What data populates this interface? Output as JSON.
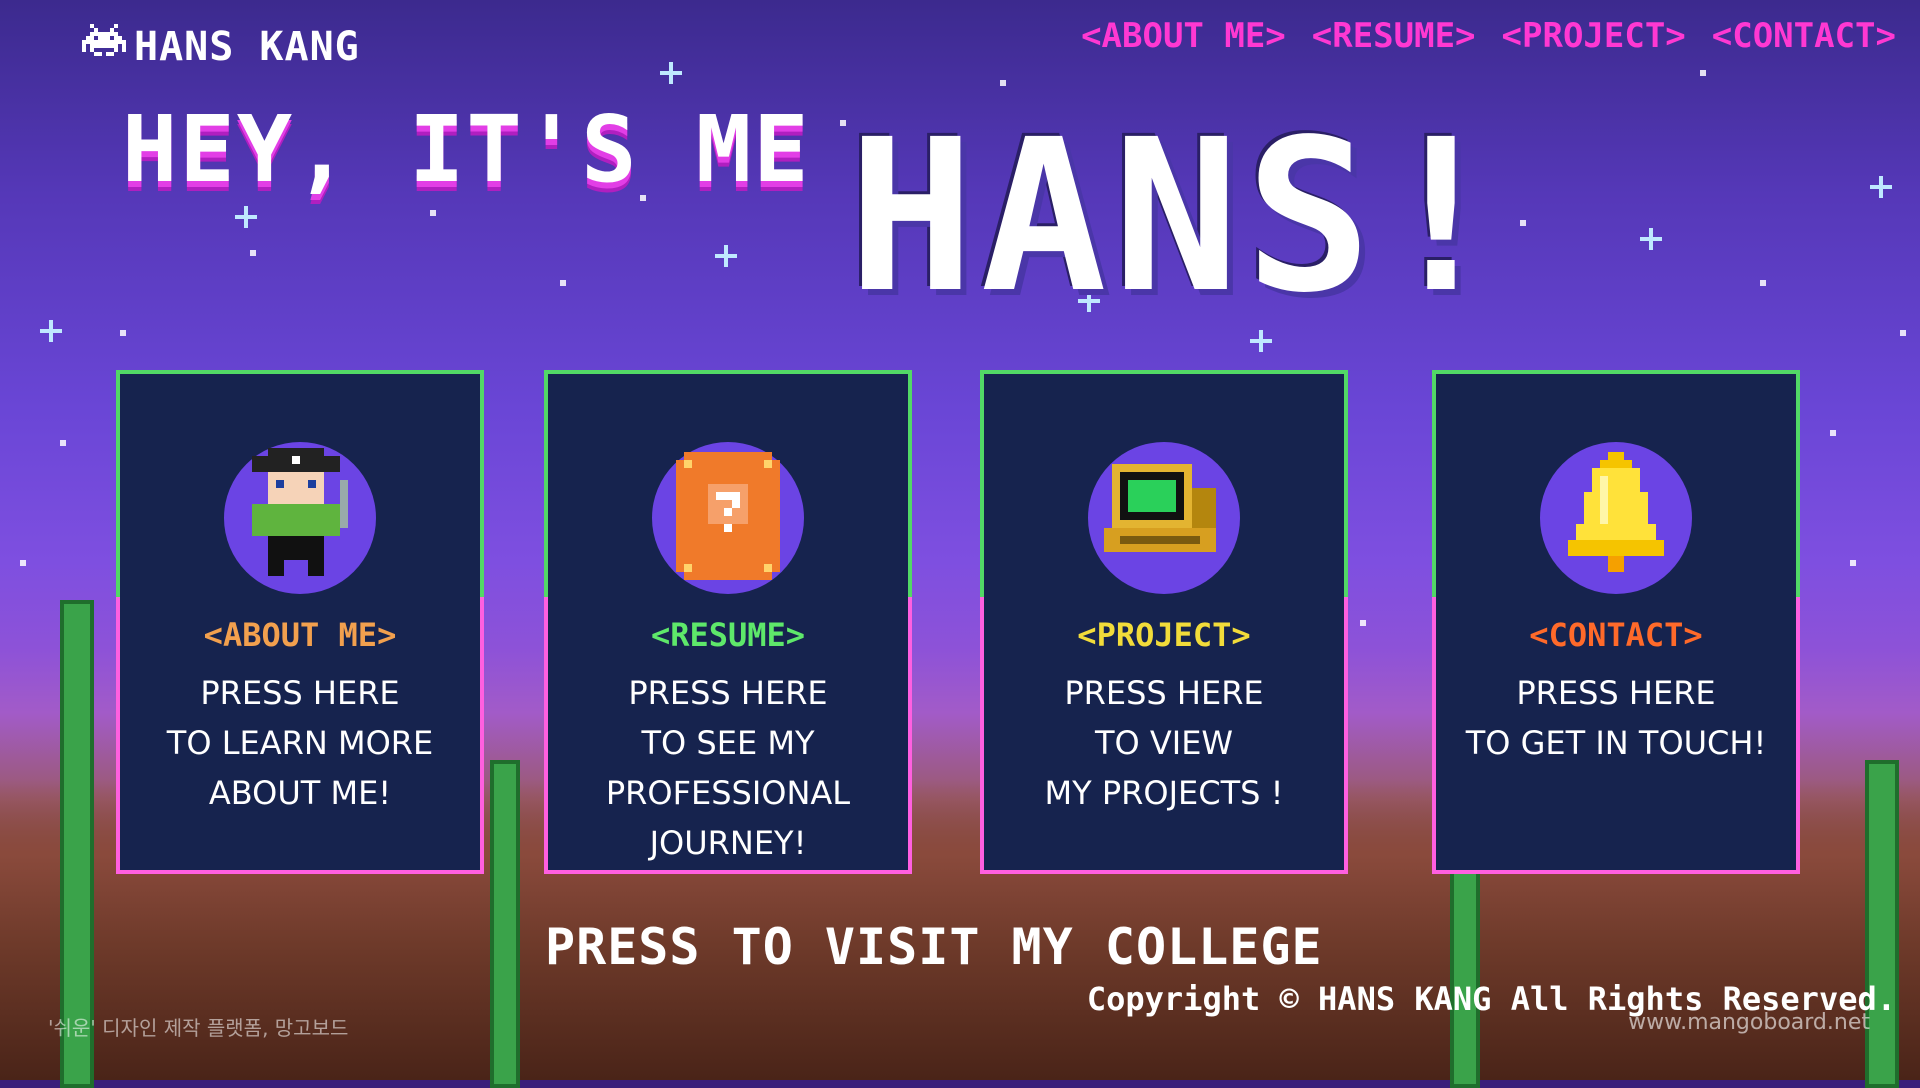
{
  "header": {
    "logo_text": "HANS KANG",
    "nav": [
      "<ABOUT ME>",
      "<RESUME>",
      "<PROJECT>",
      "<CONTACT>"
    ]
  },
  "hero": {
    "line1": "HEY, IT'S ME",
    "name": "HANS!"
  },
  "cards": [
    {
      "title": "<ABOUT ME>",
      "title_color": "#f2a04e",
      "desc": "PRESS HERE\nTO LEARN MORE\nABOUT ME!",
      "icon": "pixel-person-icon"
    },
    {
      "title": "<RESUME>",
      "title_color": "#5ee86a",
      "desc": "PRESS HERE\nTO SEE MY\nPROFESSIONAL\nJOURNEY!",
      "icon": "mystery-card-icon"
    },
    {
      "title": "<PROJECT>",
      "title_color": "#f2dc3a",
      "desc": "PRESS HERE\nTO VIEW\nMY PROJECTS !",
      "icon": "computer-icon"
    },
    {
      "title": "<CONTACT>",
      "title_color": "#ff6a2a",
      "desc": "PRESS HERE\nTO GET IN TOUCH!",
      "icon": "bell-icon"
    }
  ],
  "footer": {
    "college_link": "PRESS TO VISIT MY COLLEGE",
    "copyright": "Copyright © HANS KANG All Rights Reserved.",
    "watermark": "www.mangoboard.net",
    "korean_note": "'쉬운' 디자인 제작 플랫폼, 망고보드"
  },
  "colors": {
    "nav": "#ff38d2",
    "card_bg": "#16234e",
    "card_border_top": "#52d866",
    "card_border_bottom": "#ff5fe0"
  }
}
